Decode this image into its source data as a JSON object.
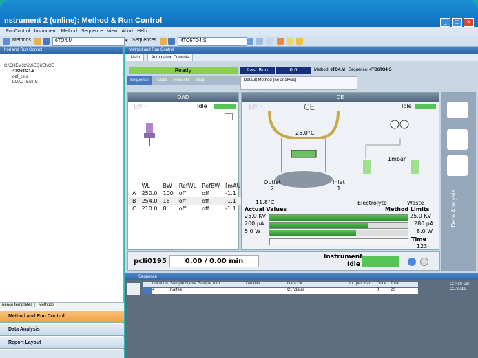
{
  "window": {
    "title": "nstrument 2 (online): Method & Run Control"
  },
  "menu": [
    "RunControl",
    "Instrument",
    "Method",
    "Sequence",
    "View",
    "Abort",
    "Help"
  ],
  "toolbar": {
    "methods_label": "Methods",
    "method_value": "6TO4.M",
    "sequences_label": "Sequences",
    "sequence_value": "4TO6TO4.S"
  },
  "left": {
    "header": "hod and Run Control",
    "tree": [
      "C:\\CHEM32\\2\\SEQUENCE",
      "4TO6TO4.S",
      "def_ce.s",
      "LOADTEST.S"
    ],
    "tabs": [
      "uence templates",
      "Methods"
    ],
    "nav": [
      "Method and Run Control",
      "Data Analysis",
      "Report Layout"
    ]
  },
  "main": {
    "header": "Method and Run Control",
    "tabs": [
      "Main",
      "Automation Controls"
    ],
    "status": {
      "ready": "Ready",
      "last_run": "Last Run",
      "last_run_value": "0.0",
      "method_label": "Method:",
      "method": "6TO4.M",
      "sequence_label": "Sequence:",
      "sequence": "4TO6TO4.S"
    },
    "buttons": {
      "sequence": "Sequence",
      "pause": "Pause",
      "resume": "Resume",
      "stop": "Stop"
    },
    "default_method": "Default Method (no analysis)"
  },
  "dad": {
    "title": "DAD",
    "emf": "EMF",
    "state": "Idle",
    "headers": [
      "",
      "WL",
      "BW",
      "RefWL",
      "RefBW",
      "[mAU]"
    ],
    "rows": [
      [
        "A",
        "250.0",
        "100",
        "off",
        "off",
        "-1.1"
      ],
      [
        "B",
        "254.0",
        "16",
        "off",
        "off",
        "-1.1"
      ],
      [
        "C",
        "210.0",
        "8",
        "off",
        "off",
        "-1.1"
      ]
    ]
  },
  "ce": {
    "title": "CE",
    "emf": "EMF",
    "label": "CE",
    "state": "Idle",
    "temp_top": "25.0°C",
    "temp_bottom": "11.8°C",
    "pressure": "1mbar",
    "outlet": "Outlet",
    "outlet_n": "2",
    "inlet": "Inlet",
    "inlet_n": "1",
    "electrolyte": "Electrolyte",
    "waste": "Waste",
    "actual": "Actual Values",
    "limits": "Method Limits",
    "gauges": [
      {
        "actual": "25.0 KV",
        "limit": "25.0 KV",
        "fraction": 1.0
      },
      {
        "actual": "200 µA",
        "limit": "280 µA",
        "fraction": 0.714
      },
      {
        "actual": "5.0 W",
        "limit": "8.0 W",
        "fraction": 0.625
      }
    ],
    "time_label": "Time",
    "time_value": "123"
  },
  "runbar": {
    "name": "pcli0195",
    "progress": "0.00 / 0.00 min",
    "instrument": "Instrument",
    "inst_state": "Idle"
  },
  "side": {
    "label": "Data Analysis"
  },
  "sequence": {
    "header": "Sequence",
    "columns": [
      "Location",
      "Sample Name",
      "Sample Info",
      "Datafile",
      "Data Dir.",
      "Inj. per Vial",
      "Done",
      "Total"
    ],
    "row": [
      "4",
      "Kaffee",
      "",
      "",
      "C:..\\data\\",
      "",
      "0",
      "20"
    ],
    "disk": "C: >10 GB",
    "disk_path": "C:..\\data\\"
  },
  "colors": {
    "ready": "#8ccf4e",
    "lastrun": "#1a2f7a",
    "idle": "#56c456",
    "accent": "#2d65a8"
  }
}
